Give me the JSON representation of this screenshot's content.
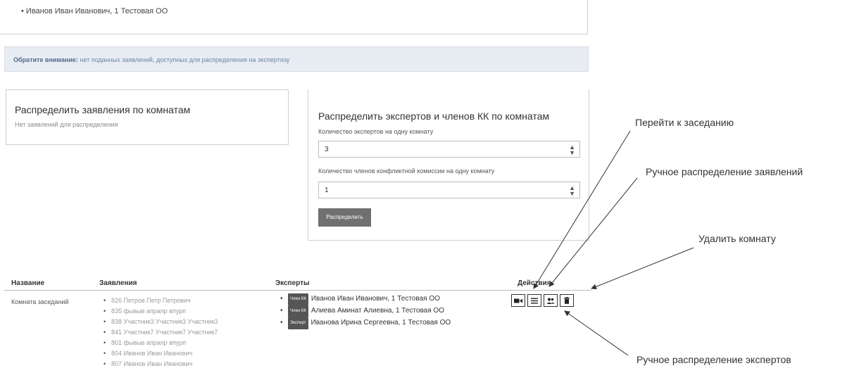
{
  "top": {
    "bullet_text": "Иванов Иван Иванович, 1 Тестовая ОО"
  },
  "alert": {
    "strong": "Обратите внимание:",
    "text": " нет поданных заявлений, доступных для распределения на экспертизу"
  },
  "left_card": {
    "title": "Распределить заявления по комнатам",
    "text": "Нет заявлений для распределения"
  },
  "right_card": {
    "title": "Распределить экспертов и членов КК по комнатам",
    "experts_label": "Количество экспертов на одну комнату",
    "experts_value": "3",
    "kk_label": "Количество членов конфликтной комиссии на одну комнату",
    "kk_value": "1",
    "button_label": "Распределить"
  },
  "table": {
    "headers": {
      "name": "Название",
      "apps": "Заявления",
      "experts": "Эксперты",
      "actions": "Действия"
    },
    "row": {
      "name": "Комната заседаний",
      "applications": [
        "826 Петров Петр Петрович",
        "835 фывыв апрапр впурп",
        "838 Участник3 Участник3 Участник3",
        "841 Участник7 Участник7 Участник7",
        "801 фывыв апрапр впурп",
        "804 Иванов Иван Иванович",
        "807 Иванов Иван Иванович"
      ],
      "experts": [
        {
          "badge": "Член КК",
          "text": "Иванов Иван Иванович, 1 Тестовая ОО"
        },
        {
          "badge": "Член КК",
          "text": "Алиева Аминат Алиевна, 1 Тестовая ОО"
        },
        {
          "badge": "Эксперт",
          "text": "Иванова Ирина Сергеевна, 1 Тестовая ОО"
        }
      ]
    }
  },
  "annotations": {
    "go_to_meeting": "Перейти к заседанию",
    "manual_apps": "Ручное распределение заявлений",
    "delete_room": "Удалить комнату",
    "manual_experts": "Ручное распределение экспертов"
  },
  "icons": {
    "action_1": "video-camera-icon",
    "action_2": "list-icon",
    "action_3": "users-icon",
    "action_4": "trash-icon"
  }
}
